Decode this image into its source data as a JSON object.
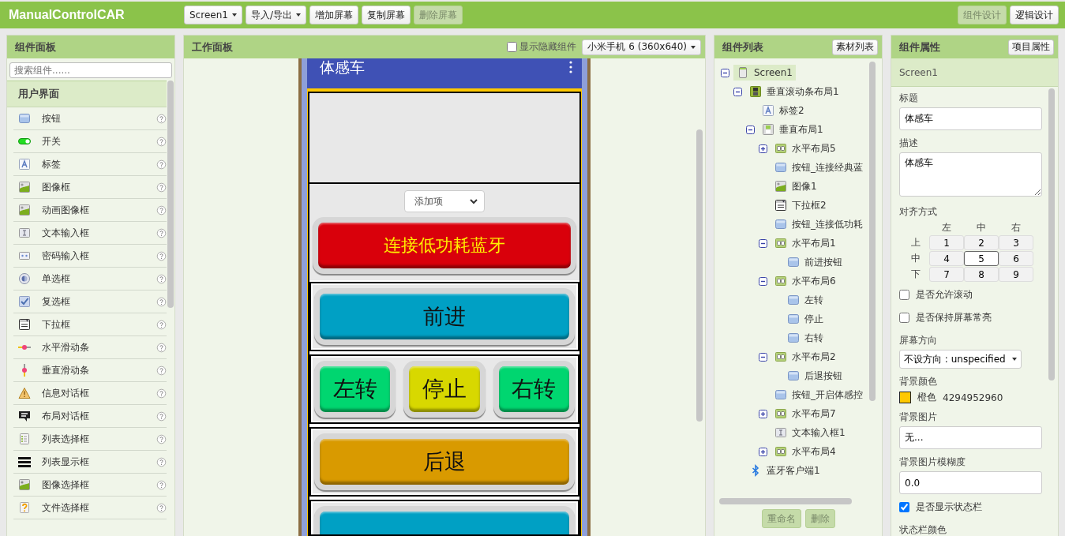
{
  "topbar": {
    "project": "ManualControlCAR",
    "buttons": [
      {
        "label": "Screen1",
        "dropdown": true,
        "disabled": false
      },
      {
        "label": "导入/导出",
        "dropdown": true,
        "disabled": false
      },
      {
        "label": "增加屏幕",
        "dropdown": false,
        "disabled": false
      },
      {
        "label": "复制屏幕",
        "dropdown": false,
        "disabled": false
      },
      {
        "label": "删除屏幕",
        "dropdown": false,
        "disabled": true
      }
    ],
    "modes": [
      {
        "label": "组件设计",
        "selected": true
      },
      {
        "label": "逻辑设计",
        "selected": false
      }
    ]
  },
  "palette": {
    "title": "组件面板",
    "placeholder": "搜索组件......",
    "category": "用户界面",
    "items": [
      {
        "label": "按钮",
        "kind": "button"
      },
      {
        "label": "开关",
        "kind": "switch"
      },
      {
        "label": "标签",
        "kind": "label"
      },
      {
        "label": "图像框",
        "kind": "image"
      },
      {
        "label": "动画图像框",
        "kind": "image"
      },
      {
        "label": "文本输入框",
        "kind": "textbox"
      },
      {
        "label": "密码输入框",
        "kind": "password"
      },
      {
        "label": "单选框",
        "kind": "radio"
      },
      {
        "label": "复选框",
        "kind": "checkbox"
      },
      {
        "label": "下拉框",
        "kind": "spinner"
      },
      {
        "label": "水平滑动条",
        "kind": "hslider"
      },
      {
        "label": "垂直滑动条",
        "kind": "vslider"
      },
      {
        "label": "信息对话框",
        "kind": "warning"
      },
      {
        "label": "布局对话框",
        "kind": "dialog"
      },
      {
        "label": "列表选择框",
        "kind": "listpicker"
      },
      {
        "label": "列表显示框",
        "kind": "listview"
      },
      {
        "label": "图像选择框",
        "kind": "imagepicker"
      },
      {
        "label": "文件选择框",
        "kind": "file"
      }
    ]
  },
  "viewer": {
    "title": "工作面板",
    "show_hidden": {
      "label": "显示隐藏组件",
      "checked": false
    },
    "device": "小米手机 6 (360x640)",
    "phone": {
      "title": "体感车",
      "rows": [
        {
          "kind": "spinner",
          "label": "添加项"
        },
        {
          "kind": "buttons",
          "buttons": [
            {
              "label": "连接低功耗蓝牙",
              "color": "#d9000b",
              "kind": "alert"
            }
          ]
        },
        {
          "kind": "buttons",
          "buttons": [
            {
              "label": "前进",
              "color": "#00a0c4",
              "kind": "plain"
            }
          ]
        },
        {
          "kind": "buttons",
          "buttons": [
            {
              "label": "左转",
              "color": "#00d670",
              "kind": "plain"
            },
            {
              "label": "停止",
              "color": "#d8d800",
              "kind": "plain"
            },
            {
              "label": "右转",
              "color": "#00d670",
              "kind": "plain"
            }
          ]
        },
        {
          "kind": "buttons",
          "buttons": [
            {
              "label": "后退",
              "color": "#d99a00",
              "kind": "plain"
            }
          ]
        },
        {
          "kind": "buttons",
          "buttons": [
            {
              "color": "#00a0c4"
            }
          ]
        }
      ]
    }
  },
  "tree": {
    "title": "组件列表",
    "button": "素材列表",
    "nodes": [
      {
        "label": "Screen1",
        "kind": "screen",
        "selected": true,
        "expanded": true,
        "children": [
          {
            "label": "垂直滚动条布局1",
            "kind": "vscroll",
            "selected": false,
            "expanded": true,
            "children": [
              {
                "label": "标签2",
                "kind": "label",
                "selected": false
              },
              {
                "label": "垂直布局1",
                "kind": "vlayout",
                "selected": false,
                "expanded": true,
                "children": [
                  {
                    "label": "水平布局5",
                    "kind": "hlayout",
                    "selected": false,
                    "expanded": false
                  },
                  {
                    "label": "按钮_连接经典蓝",
                    "kind": "button",
                    "selected": false
                  },
                  {
                    "label": "图像1",
                    "kind": "image",
                    "selected": false
                  },
                  {
                    "label": "下拉框2",
                    "kind": "spinner",
                    "selected": false
                  },
                  {
                    "label": "按钮_连接低功耗",
                    "kind": "button",
                    "selected": false
                  },
                  {
                    "label": "水平布局1",
                    "kind": "hlayout",
                    "selected": false,
                    "expanded": true,
                    "children": [
                      {
                        "label": "前进按钮",
                        "kind": "button",
                        "selected": false
                      }
                    ]
                  },
                  {
                    "label": "水平布局6",
                    "kind": "hlayout",
                    "selected": false,
                    "expanded": true,
                    "children": [
                      {
                        "label": "左转",
                        "kind": "button",
                        "selected": false
                      },
                      {
                        "label": "停止",
                        "kind": "button",
                        "selected": false
                      },
                      {
                        "label": "右转",
                        "kind": "button",
                        "selected": false
                      }
                    ]
                  },
                  {
                    "label": "水平布局2",
                    "kind": "hlayout",
                    "selected": false,
                    "expanded": true,
                    "children": [
                      {
                        "label": "后退按钮",
                        "kind": "button",
                        "selected": false
                      }
                    ]
                  },
                  {
                    "label": "按钮_开启体感控",
                    "kind": "button",
                    "selected": false
                  },
                  {
                    "label": "水平布局7",
                    "kind": "hlayout",
                    "selected": false,
                    "expanded": false
                  },
                  {
                    "label": "文本输入框1",
                    "kind": "textbox",
                    "selected": false
                  },
                  {
                    "label": "水平布局4",
                    "kind": "hlayout",
                    "selected": false,
                    "expanded": false
                  }
                ]
              }
            ]
          },
          {
            "label": "蓝牙客户端1",
            "kind": "bluetooth",
            "selected": false
          }
        ]
      }
    ],
    "actions": [
      {
        "label": "重命名"
      },
      {
        "label": "删除"
      }
    ]
  },
  "properties": {
    "title": "组件属性",
    "button": "项目属性",
    "component": "Screen1",
    "items": [
      {
        "kind": "text",
        "label": "标题",
        "value": "体感车"
      },
      {
        "kind": "textarea",
        "label": "描述",
        "value": "体感车"
      },
      {
        "kind": "alignment",
        "label": "对齐方式",
        "columns": [
          "左",
          "中",
          "右"
        ],
        "rows": [
          "上",
          "中",
          "下"
        ],
        "cells": [
          {
            "label": "1",
            "selected": false
          },
          {
            "label": "2",
            "selected": false
          },
          {
            "label": "3",
            "selected": false
          },
          {
            "label": "4",
            "selected": false
          },
          {
            "label": "5",
            "selected": true
          },
          {
            "label": "6",
            "selected": false
          },
          {
            "label": "7",
            "selected": false
          },
          {
            "label": "8",
            "selected": false
          },
          {
            "label": "9",
            "selected": false
          }
        ]
      },
      {
        "kind": "checkbox",
        "label": "是否允许滚动",
        "checked": false
      },
      {
        "kind": "checkbox",
        "label": "是否保持屏幕常亮",
        "checked": false
      },
      {
        "kind": "select",
        "label": "屏幕方向",
        "value": "不设方向 : unspecified"
      },
      {
        "kind": "color",
        "label": "背景颜色",
        "color": "#ffc800",
        "name": "橙色",
        "value": "4294952960"
      },
      {
        "kind": "text",
        "label": "背景图片",
        "value": "无..."
      },
      {
        "kind": "text",
        "label": "背景图片模糊度",
        "value": "0.0"
      },
      {
        "kind": "checkbox",
        "label": "是否显示状态栏",
        "checked": true
      },
      {
        "kind": "heading",
        "label": "状态栏颜色"
      }
    ]
  }
}
